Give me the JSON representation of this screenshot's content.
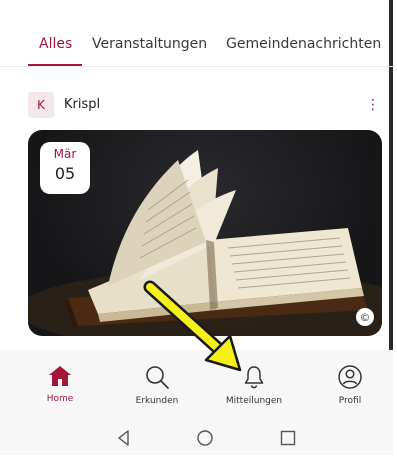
{
  "tabs": [
    {
      "label": "Alles",
      "active": true
    },
    {
      "label": "Veranstaltungen",
      "active": false
    },
    {
      "label": "Gemeindenachrichten",
      "active": false
    }
  ],
  "post": {
    "avatar_letter": "K",
    "author": "Krispl",
    "more_icon": "more-vertical-icon",
    "date": {
      "month": "Mär",
      "day": "05"
    },
    "copyright_symbol": "©"
  },
  "bottom_nav": [
    {
      "label": "Home",
      "icon": "home-icon",
      "active": true
    },
    {
      "label": "Erkunden",
      "icon": "search-icon",
      "active": false
    },
    {
      "label": "Mitteilungen",
      "icon": "bell-icon",
      "active": false
    },
    {
      "label": "Profil",
      "icon": "profile-icon",
      "active": false
    }
  ],
  "system_nav": [
    "back-icon",
    "home-circle-icon",
    "recent-apps-icon"
  ],
  "colors": {
    "accent": "#a3173a",
    "arrow": "#f5f01a"
  }
}
